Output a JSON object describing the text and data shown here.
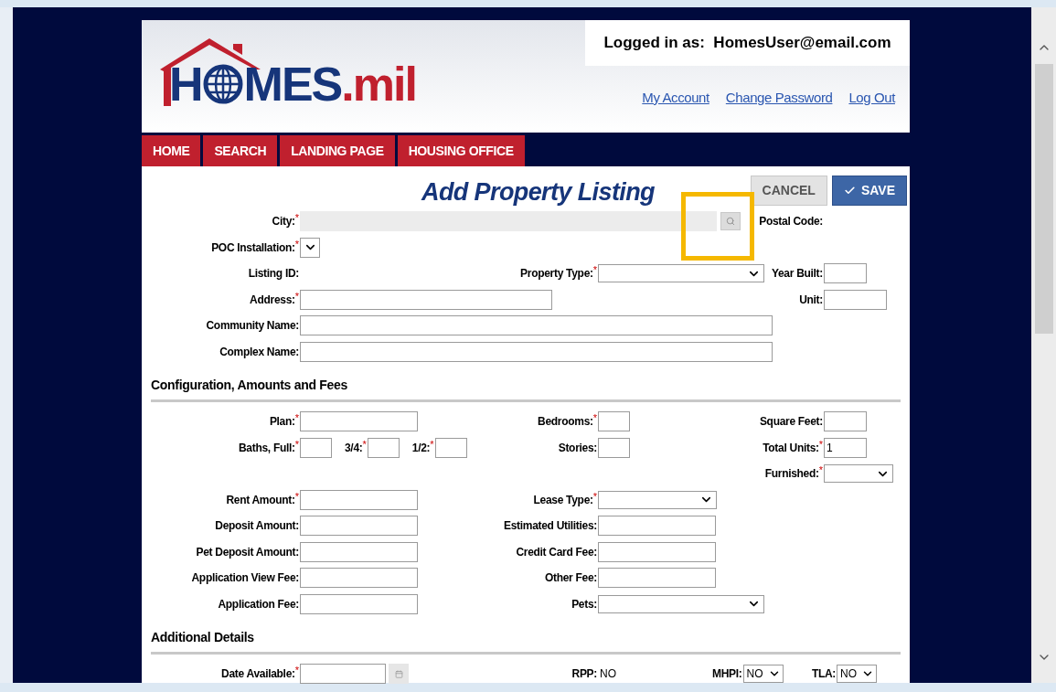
{
  "header": {
    "logo": {
      "first": "H",
      "rest": "MES",
      ".suffix": ".mil"
    },
    "logged_in": "Logged in as:  HomesUser@email.com",
    "links": [
      "My Account",
      "Change Password",
      "Log Out"
    ]
  },
  "nav": [
    {
      "label": "HOME",
      "selected": false
    },
    {
      "label": "SEARCH",
      "selected": false
    },
    {
      "label": "LANDING PAGE",
      "selected": false
    },
    {
      "label": "HOUSING OFFICE",
      "selected": false
    }
  ],
  "form": {
    "title": "Add Property Listing",
    "buttons": [
      {
        "label": "CANCEL",
        "kind": "secondary"
      },
      {
        "label": "SAVE",
        "kind": "primary"
      }
    ],
    "sections": [
      {
        "rows": [
          {
            "left": [
              {
                "label": "City:",
                "mark": "*",
                "kind": "search"
              }
            ],
            "right": [
              {
                "label": "Postal Code:",
                "kind": "none"
              }
            ]
          },
          {
            "left": [
              {
                "label": "POC Installation:",
                "mark": "*",
                "kind": "mini-select"
              }
            ]
          },
          {
            "left": [
              {
                "label": "Listing ID:",
                "kind": "none"
              }
            ],
            "mid": [
              {
                "label": "Property Type:",
                "mark": "*",
                "kind": "select"
              }
            ],
            "right": [
              {
                "label": "Year Built:",
                "kind": "tiny"
              }
            ]
          },
          {
            "left": [
              {
                "label": "Address:",
                "mark": "*",
                "kind": "long"
              }
            ],
            "right": [
              {
                "label": "Unit:",
                "kind": "short"
              }
            ]
          },
          {
            "left": [
              {
                "label": "Community Name:",
                "kind": "wide"
              }
            ]
          },
          {
            "left": [
              {
                "label": "Complex Name:",
                "kind": "wide"
              }
            ]
          }
        ]
      },
      {
        "heading": "Configuration, Amounts and Fees",
        "rows": [
          {
            "left": [
              {
                "label": "Plan:",
                "mark": "*",
                "kind": "text"
              }
            ],
            "mid": [
              {
                "label": "Bedrooms:",
                "mark": "*",
                "kind": "mini"
              }
            ],
            "right": [
              {
                "label": "Square Feet:",
                "kind": "tiny"
              }
            ]
          },
          {
            "left": [
              {
                "label": "Baths, Full:",
                "mark": "*",
                "kind": "mini"
              },
              {
                "label": "3/4:",
                "mark": "*",
                "kind": "mini"
              },
              {
                "label": "1/2:",
                "mark": "*",
                "kind": "mini"
              }
            ],
            "mid": [
              {
                "label": "Stories:",
                "kind": "mini"
              }
            ],
            "right": [
              {
                "label": "Total Units:",
                "mark": "*",
                "kind": "tiny",
                "value": "1"
              }
            ]
          },
          {
            "right": [
              {
                "label": "Furnished:",
                "mark": "*",
                "kind": "small-select"
              }
            ]
          },
          {
            "left": [
              {
                "label": "Rent Amount:",
                "mark": "*",
                "kind": "text"
              }
            ],
            "mid": [
              {
                "label": "Lease Type:",
                "mark": "*",
                "kind": "select-mid"
              }
            ]
          },
          {
            "left": [
              {
                "label": "Deposit Amount:",
                "kind": "text"
              }
            ],
            "mid": [
              {
                "label": "Estimated Utilities:",
                "kind": "text"
              }
            ]
          },
          {
            "left": [
              {
                "label": "Pet Deposit Amount:",
                "kind": "text"
              }
            ],
            "mid": [
              {
                "label": "Credit Card Fee:",
                "kind": "text"
              }
            ]
          },
          {
            "left": [
              {
                "label": "Application View Fee:",
                "kind": "text"
              }
            ],
            "mid": [
              {
                "label": "Other Fee:",
                "kind": "text"
              }
            ]
          },
          {
            "left": [
              {
                "label": "Application Fee:",
                "kind": "text"
              }
            ],
            "mid": [
              {
                "label": "Pets:",
                "kind": "select"
              }
            ]
          }
        ]
      },
      {
        "heading": "Additional Details",
        "rows": [
          {
            "left": [
              {
                "label": "Date Available:",
                "mark": "*",
                "kind": "date"
              }
            ],
            "mid": [
              {
                "label": "RPP:",
                "kind": "static",
                "value": "NO"
              },
              {
                "label": "MHPI:",
                "kind": "value-select",
                "value": "NO"
              }
            ],
            "right": [
              {
                "label": "TLA:",
                "kind": "value-select",
                "value": "NO"
              }
            ]
          }
        ]
      }
    ]
  }
}
